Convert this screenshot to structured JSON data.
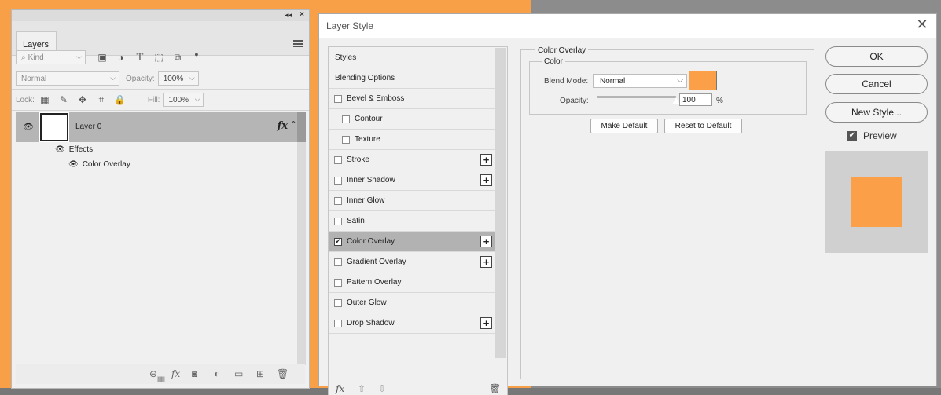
{
  "colors": {
    "accent": "#fba049",
    "overlay_color": "#fba049"
  },
  "layers_panel": {
    "tab_label": "Layers",
    "filter_kind": "Kind",
    "blend_mode": "Normal",
    "opacity_label": "Opacity:",
    "opacity_value": "100%",
    "lock_label": "Lock:",
    "fill_label": "Fill:",
    "fill_value": "100%",
    "layer": {
      "name": "Layer 0",
      "fx": "fx"
    },
    "effects_label": "Effects",
    "effect_item": "Color Overlay"
  },
  "dialog": {
    "title": "Layer Style",
    "styles": [
      {
        "label": "Styles",
        "type": "header"
      },
      {
        "label": "Blending Options",
        "type": "header"
      },
      {
        "label": "Bevel & Emboss",
        "type": "check",
        "checked": false,
        "plus": false,
        "indent": false
      },
      {
        "label": "Contour",
        "type": "check",
        "checked": false,
        "plus": false,
        "indent": true
      },
      {
        "label": "Texture",
        "type": "check",
        "checked": false,
        "plus": false,
        "indent": true
      },
      {
        "label": "Stroke",
        "type": "check",
        "checked": false,
        "plus": true,
        "indent": false
      },
      {
        "label": "Inner Shadow",
        "type": "check",
        "checked": false,
        "plus": true,
        "indent": false
      },
      {
        "label": "Inner Glow",
        "type": "check",
        "checked": false,
        "plus": false,
        "indent": false
      },
      {
        "label": "Satin",
        "type": "check",
        "checked": false,
        "plus": false,
        "indent": false
      },
      {
        "label": "Color Overlay",
        "type": "check",
        "checked": true,
        "plus": true,
        "indent": false,
        "selected": true
      },
      {
        "label": "Gradient Overlay",
        "type": "check",
        "checked": false,
        "plus": true,
        "indent": false
      },
      {
        "label": "Pattern Overlay",
        "type": "check",
        "checked": false,
        "plus": false,
        "indent": false
      },
      {
        "label": "Outer Glow",
        "type": "check",
        "checked": false,
        "plus": false,
        "indent": false
      },
      {
        "label": "Drop Shadow",
        "type": "check",
        "checked": false,
        "plus": true,
        "indent": false
      }
    ],
    "fx_label": "fx",
    "color_overlay": {
      "section_title": "Color Overlay",
      "group_title": "Color",
      "blend_mode_label": "Blend Mode:",
      "blend_mode_value": "Normal",
      "opacity_label": "Opacity:",
      "opacity_value": "100",
      "opacity_unit": "%",
      "opacity_level": 1.0,
      "make_default": "Make Default",
      "reset_default": "Reset to Default"
    },
    "buttons": {
      "ok": "OK",
      "cancel": "Cancel",
      "new_style": "New Style..."
    },
    "preview_label": "Preview",
    "preview_checked": true
  }
}
